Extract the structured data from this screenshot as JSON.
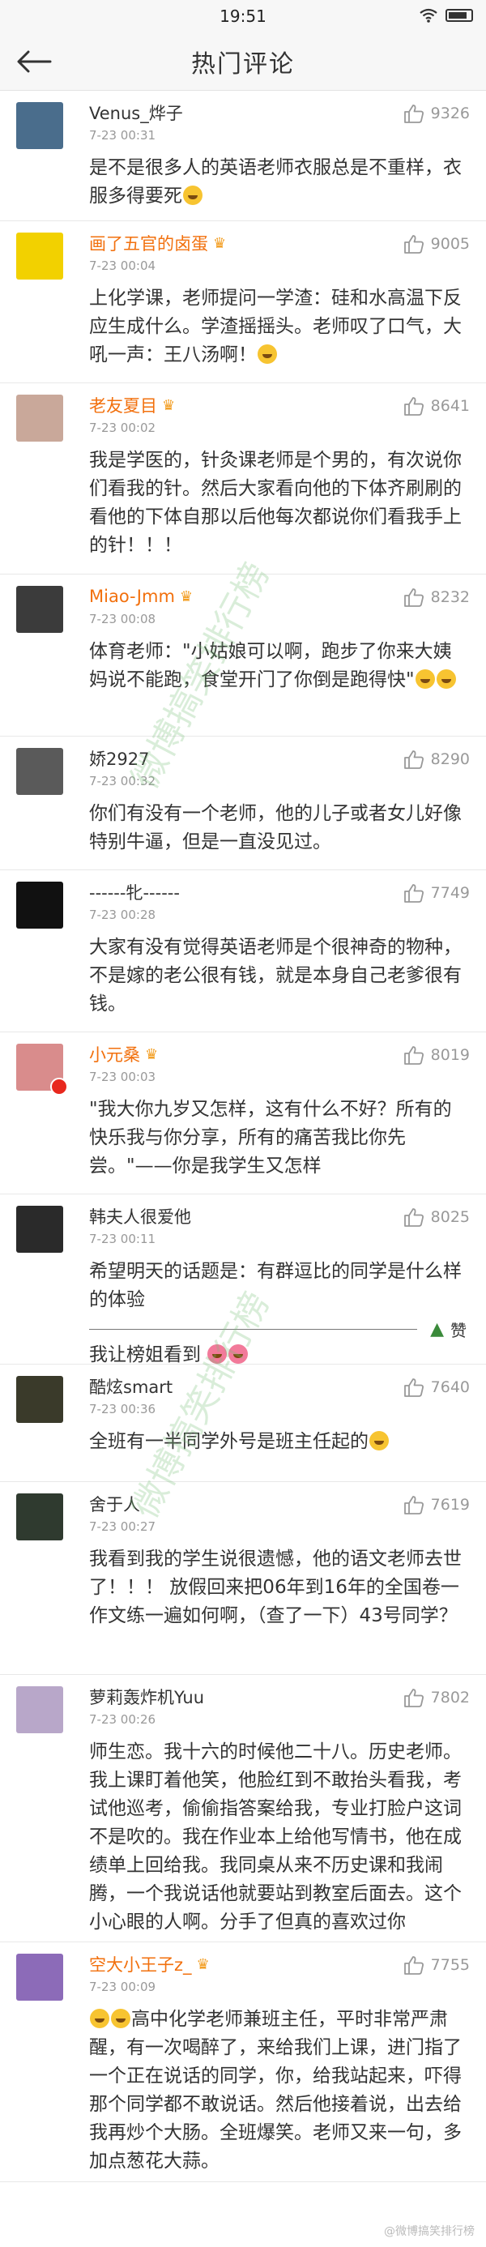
{
  "status_bar": {
    "time": "19:51"
  },
  "nav": {
    "title": "热门评论"
  },
  "comments": [
    {
      "user": "Venus_烨子",
      "vip": false,
      "time": "7-23 00:31",
      "likes": "9326",
      "text": "是不是很多人的英语老师衣服总是不重样，衣服多得要死",
      "avatar_color": "#4a6d8c"
    },
    {
      "user": "画了五官的卤蛋",
      "vip": true,
      "time": "7-23 00:04",
      "likes": "9005",
      "text": "上化学课，老师提问一学渣：硅和水高温下反应生成什么。学渣摇摇头。老师叹了口气，大吼一声：王八汤啊！",
      "avatar_color": "#f2d100"
    },
    {
      "user": "老友夏目",
      "vip": true,
      "time": "7-23 00:02",
      "likes": "8641",
      "text": "我是学医的，针灸课老师是个男的，有次说你们看我的针。然后大家看向他的下体齐刷刷的看他的下体自那以后他每次都说你们看我手上的针！！！",
      "avatar_color": "#c9a89a"
    },
    {
      "user": "Miao-Jmm",
      "vip": true,
      "time": "7-23 00:08",
      "likes": "8232",
      "text": "体育老师：\"小姑娘可以啊，跑步了你来大姨妈说不能跑，食堂开门了你倒是跑得快\"",
      "avatar_color": "#3b3b3b"
    },
    {
      "user": "娇2927",
      "vip": false,
      "time": "7-23 00:32",
      "likes": "8290",
      "text": "你们有没有一个老师，他的儿子或者女儿好像特别牛逼，但是一直没见过。",
      "avatar_color": "#5a5a5a"
    },
    {
      "user": "------牝------",
      "vip": false,
      "time": "7-23 00:28",
      "likes": "7749",
      "text": "大家有没有觉得英语老师是个很神奇的物种，不是嫁的老公很有钱，就是本身自己老爹很有钱。",
      "avatar_color": "#111111"
    },
    {
      "user": "小元桑",
      "vip": true,
      "time": "7-23 00:03",
      "likes": "8019",
      "text": "\"我大你九岁又怎样，这有什么不好？所有的快乐我与你分享，所有的痛苦我比你先尝。\"——你是我学生又怎样",
      "avatar_color": "#d98c8c",
      "badge": true
    },
    {
      "user": "韩夫人很爱他",
      "vip": false,
      "time": "7-23 00:11",
      "likes": "8025",
      "text": "希望明天的话题是：有群逗比的同学是什么样的体验",
      "sub_text": "我让榜姐看到",
      "zan": "赞",
      "avatar_color": "#2a2a2a"
    },
    {
      "user": "酷炫smart",
      "vip": false,
      "time": "7-23 00:36",
      "likes": "7640",
      "text": "全班有一半同学外号是班主任起的",
      "avatar_color": "#3a3a2a"
    },
    {
      "user": "舍于人",
      "vip": false,
      "time": "7-23 00:27",
      "likes": "7619",
      "text": "我看到我的学生说很遗憾，他的语文老师去世了！！！ 放假回来把06年到16年的全国卷一作文练一遍如何啊，（查了一下）43号同学？",
      "avatar_color": "#2f3a2f"
    },
    {
      "user": "萝莉轰炸机Yuu",
      "vip": false,
      "time": "7-23 00:26",
      "likes": "7802",
      "text": "师生恋。我十六的时候他二十八。历史老师。我上课盯着他笑，他脸红到不敢抬头看我，考试他巡考，偷偷指答案给我，专业打脸户这词不是吹的。我在作业本上给他写情书，他在成绩单上回给我。我同桌从来不历史课和我闹腾，一个我说话他就要站到教室后面去。这个小心眼的人啊。分手了但真的喜欢过你",
      "avatar_color": "#b8a7c9"
    },
    {
      "user": "空大小王子z_",
      "vip": true,
      "time": "7-23 00:09",
      "likes": "7755",
      "text": "高中化学老师兼班主任，平时非常严肃醒，有一次喝醉了，来给我们上课，进门指了一个正在说话的同学，你，给我站起来，吓得那个同学都不敢说话。然后他接着说，出去给我再炒个大肠。全班爆笑。老师又来一句，多加点葱花大蒜。",
      "avatar_color": "#8c6bb8"
    }
  ],
  "watermark": {
    "text": "微博搞笑排行榜"
  },
  "footer": {
    "text": "@微博搞笑排行榜"
  }
}
